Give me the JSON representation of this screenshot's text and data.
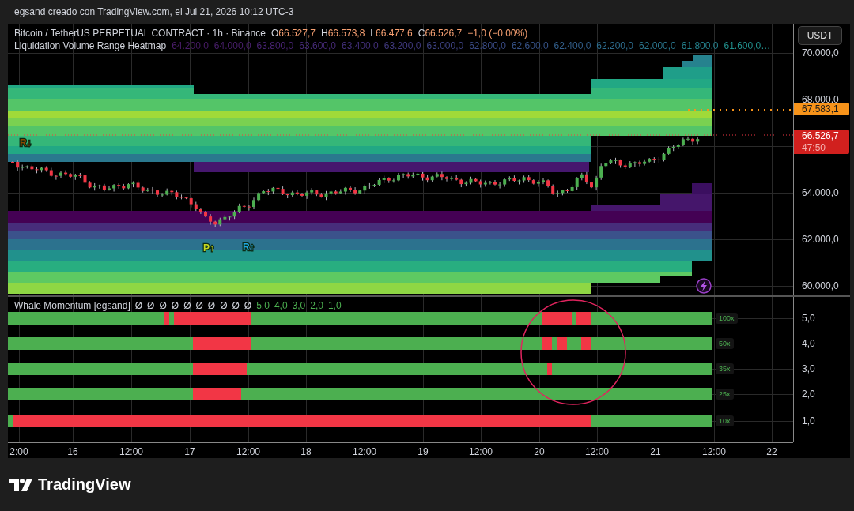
{
  "header": {
    "text": "egsand creado con TradingView.com, el Jul 21, 2026 10:12 UTC-3"
  },
  "main_pane": {
    "title": "Bitcoin / TetherUS PERPETUAL CONTRACT · 1h · Binance",
    "ohlc": [
      {
        "label": "O",
        "value": "66.527,7"
      },
      {
        "label": "H",
        "value": "66.573,8"
      },
      {
        "label": "L",
        "value": "66.477,6"
      },
      {
        "label": "C",
        "value": "66.526,7"
      }
    ],
    "change": "−1,0 (−0,00%)",
    "heatmap_title": "Liquidation Volume Range Heatmap",
    "heatmap_levels": [
      {
        "text": "64.200,0",
        "color": "#4b1d6b"
      },
      {
        "text": "64.000,0",
        "color": "#4a1f6e"
      },
      {
        "text": "63.800,0",
        "color": "#482373"
      },
      {
        "text": "63.600,0",
        "color": "#462a78"
      },
      {
        "text": "63.400,0",
        "color": "#43307c"
      },
      {
        "text": "63.200,0",
        "color": "#40397f"
      },
      {
        "text": "63.000,0",
        "color": "#3d4282"
      },
      {
        "text": "62.800,0",
        "color": "#3a4b86"
      },
      {
        "text": "62.600,0",
        "color": "#37548a"
      },
      {
        "text": "62.400,0",
        "color": "#325f8c"
      },
      {
        "text": "62.200,0",
        "color": "#2d6c8e"
      },
      {
        "text": "62.000,0",
        "color": "#2a768e"
      },
      {
        "text": "61.800,0",
        "color": "#25828e"
      },
      {
        "text": "61.600,0…",
        "color": "#21908d"
      }
    ],
    "markers": [
      {
        "text": "R",
        "arrow": "↓",
        "color": "#8a4800"
      },
      {
        "text": "P",
        "arrow": "↑",
        "color": "#c8d820"
      },
      {
        "text": "R",
        "arrow": "↑",
        "color": "#1fa8e0"
      }
    ]
  },
  "price_axis": {
    "currency_button": "USDT",
    "ticks": [
      "70.000,0",
      "68.000,0",
      "64.000,0",
      "62.000,0",
      "60.000,0"
    ],
    "price_tags": [
      {
        "kind": "line",
        "text": "67.583,1"
      },
      {
        "kind": "last",
        "text": "66.526,7",
        "countdown": "47:50"
      }
    ]
  },
  "indicator_pane": {
    "title": "Whale Momentum [egsand]",
    "values": [
      {
        "text": "Ø",
        "color": "#d1d4dc"
      },
      {
        "text": "Ø",
        "color": "#d1d4dc"
      },
      {
        "text": "Ø",
        "color": "#d1d4dc"
      },
      {
        "text": "Ø",
        "color": "#d1d4dc"
      },
      {
        "text": "Ø",
        "color": "#d1d4dc"
      },
      {
        "text": "Ø",
        "color": "#d1d4dc"
      },
      {
        "text": "Ø",
        "color": "#d1d4dc"
      },
      {
        "text": "Ø",
        "color": "#d1d4dc"
      },
      {
        "text": "Ø",
        "color": "#d1d4dc"
      },
      {
        "text": "Ø",
        "color": "#d1d4dc"
      },
      {
        "text": "5,0",
        "color": "#4caf50"
      },
      {
        "text": "4,0",
        "color": "#4caf50"
      },
      {
        "text": "3,0",
        "color": "#4caf50"
      },
      {
        "text": "2,0",
        "color": "#4caf50"
      },
      {
        "text": "1,0",
        "color": "#4caf50"
      }
    ],
    "rows": [
      {
        "label": "100x"
      },
      {
        "label": "50x"
      },
      {
        "label": "35x"
      },
      {
        "label": "25x"
      },
      {
        "label": "10x"
      }
    ],
    "axis_ticks": [
      "5,0",
      "4,0",
      "3,0",
      "2,0",
      "1,0"
    ]
  },
  "time_axis": {
    "labels": [
      "2:00",
      "16",
      "12:00",
      "17",
      "12:00",
      "18",
      "12:00",
      "19",
      "12:00",
      "20",
      "12:00",
      "21",
      "12:00",
      "22"
    ]
  },
  "footer": {
    "logo_text": "TradingView"
  }
}
